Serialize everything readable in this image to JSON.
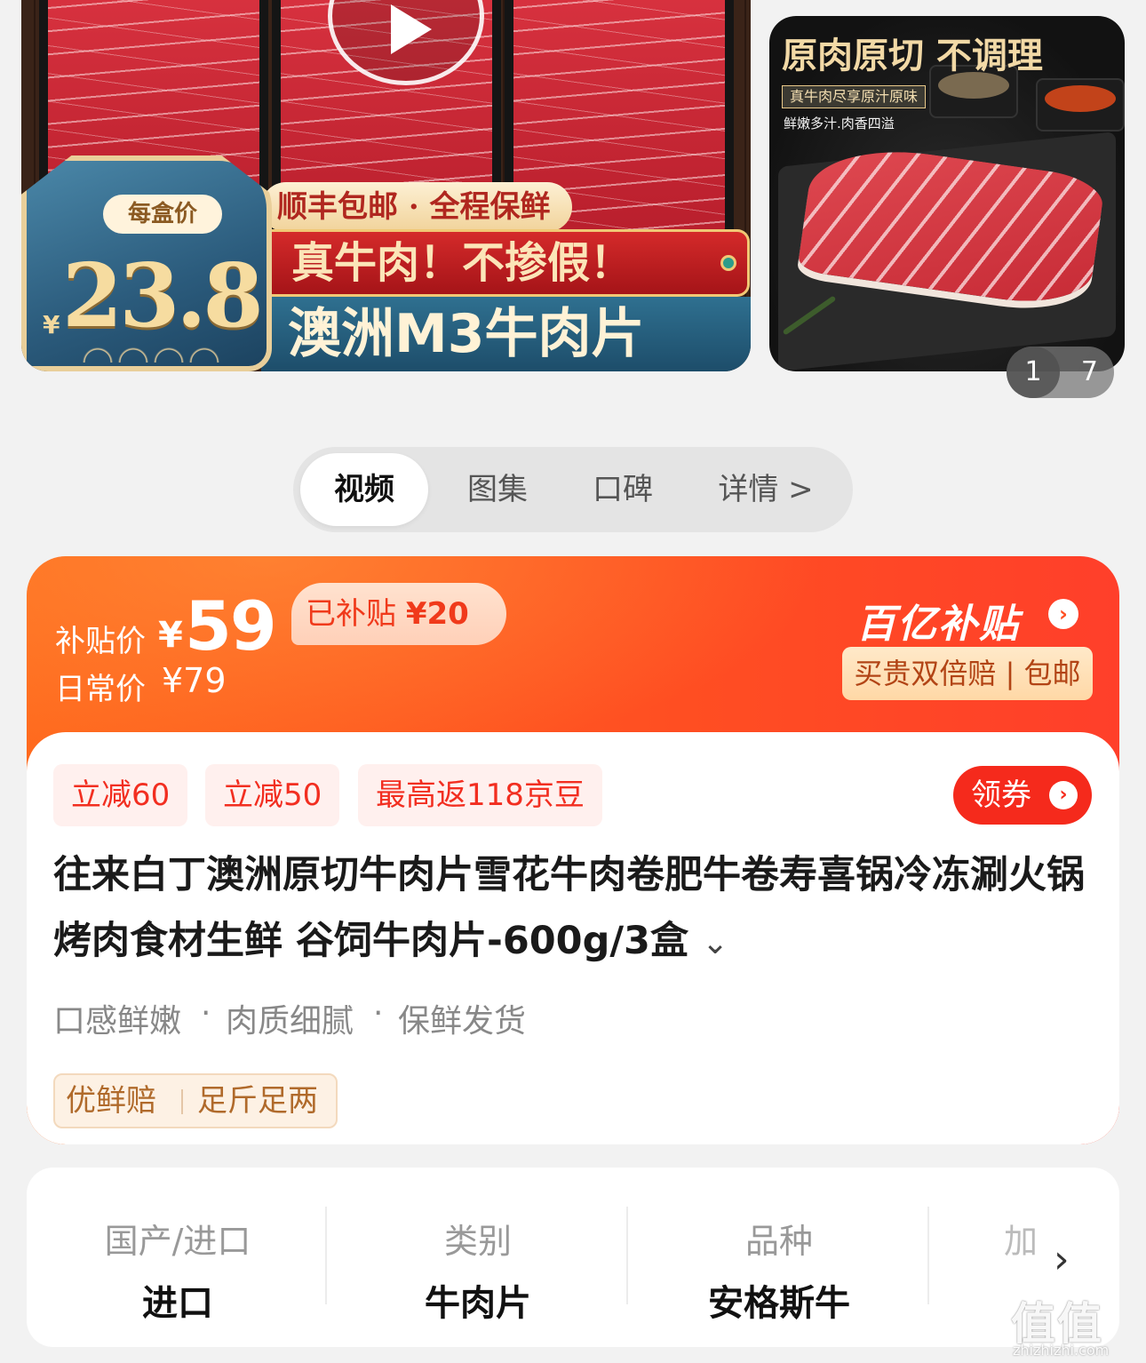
{
  "gallery": {
    "main_image": {
      "badge_label": "每盒价",
      "badge_currency": "¥",
      "badge_price": "23.8",
      "ribbon_top": "顺丰包邮 · 全程保鲜",
      "ribbon_mid": "真牛肉！不掺假！",
      "ribbon_bottom": "澳洲M3牛肉片"
    },
    "side_image": {
      "title": "原肉原切 不调理",
      "chip": "真牛肉尽享原汁原味",
      "subtitle": "鲜嫩多汁.肉香四溢"
    },
    "counter": {
      "current": "1",
      "total": "7"
    }
  },
  "tabs": [
    {
      "label": "视频",
      "active": true
    },
    {
      "label": "图集",
      "active": false
    },
    {
      "label": "口碑",
      "active": false
    },
    {
      "label": "详情 >",
      "active": false
    }
  ],
  "subsidy": {
    "price_label": "补贴价",
    "currency": "¥",
    "price": "59",
    "subsidized_chip": {
      "label": "已补贴",
      "amount": "¥20"
    },
    "normal_label": "日常价",
    "normal_price": "¥79",
    "program_logo": "百亿补贴",
    "program_arrow": "›",
    "program_tag": "买贵双倍赔 | 包邮",
    "colors": {
      "accent": "#ff4e22",
      "coupon_text": "#f22e20"
    }
  },
  "coupons": [
    "立减60",
    "立减50",
    "最高返118京豆"
  ],
  "get_coupon": {
    "label": "领券",
    "arrow": "›"
  },
  "product": {
    "title": "往来白丁澳洲原切牛肉片雪花牛肉卷肥牛卷寿喜锅冷冻涮火锅烤肉食材生鲜 谷饲牛肉片-600g/3盒",
    "expand_icon": "⌄",
    "features": [
      "口感鲜嫩",
      "肉质细腻",
      "保鲜发货"
    ],
    "feature_separator": "·",
    "guarantees": [
      "优鲜赔",
      "足斤足两"
    ]
  },
  "attributes": [
    {
      "key": "国产/进口",
      "value": "进口"
    },
    {
      "key": "类别",
      "value": "牛肉片"
    },
    {
      "key": "品种",
      "value": "安格斯牛"
    }
  ],
  "attributes_cut_label": "加",
  "attributes_next": "›",
  "watermark": {
    "big": "值值值",
    "small": "zhizhizhi.com"
  }
}
